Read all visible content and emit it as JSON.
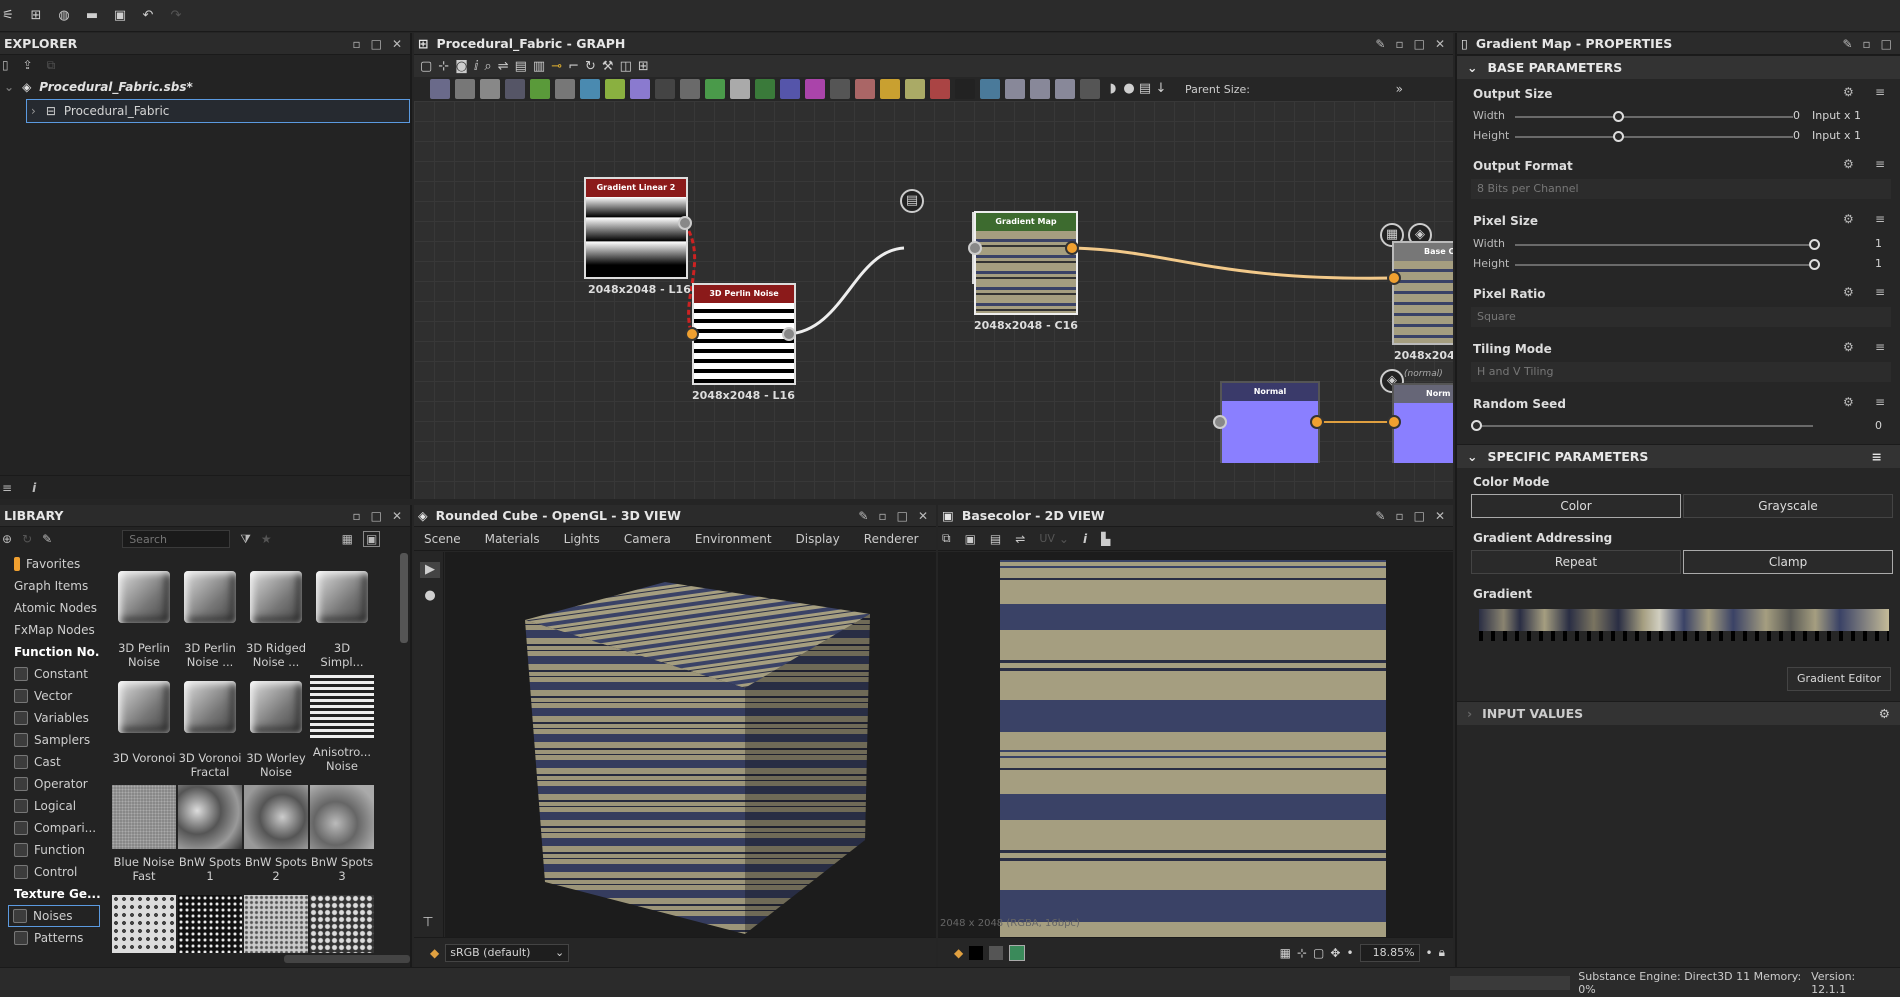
{
  "explorer": {
    "title": "EXPLORER",
    "package": "Procedural_Fabric.sbs*",
    "graph": "Procedural_Fabric"
  },
  "graph": {
    "title": "Procedural_Fabric - GRAPH",
    "parent_size_label": "Parent Size:",
    "nodes": {
      "gradient_linear": {
        "title": "Gradient Linear 2",
        "label": "2048x2048 - L16"
      },
      "perlin": {
        "title": "3D Perlin Noise",
        "label": "2048x2048 - L16"
      },
      "gradient_map": {
        "title": "Gradient Map",
        "label": "2048x2048 - C16"
      },
      "basecolor": {
        "title": "Base C",
        "label": "2048x204"
      },
      "normal": {
        "title": "Normal"
      },
      "normal_out": {
        "title": "Norm",
        "tag": "(normal)"
      }
    }
  },
  "library": {
    "title": "LIBRARY",
    "search_placeholder": "Search",
    "categories": [
      {
        "label": "Favorites",
        "bold": false
      },
      {
        "label": "Graph Items",
        "bold": false
      },
      {
        "label": "Atomic Nodes",
        "bold": false
      },
      {
        "label": "FxMap Nodes",
        "bold": false
      },
      {
        "label": "Function No...",
        "bold": true
      },
      {
        "label": "Constant",
        "bold": false
      },
      {
        "label": "Vector",
        "bold": false
      },
      {
        "label": "Variables",
        "bold": false
      },
      {
        "label": "Samplers",
        "bold": false
      },
      {
        "label": "Cast",
        "bold": false
      },
      {
        "label": "Operator",
        "bold": false
      },
      {
        "label": "Logical",
        "bold": false
      },
      {
        "label": "Compari...",
        "bold": false
      },
      {
        "label": "Function",
        "bold": false
      },
      {
        "label": "Control",
        "bold": false
      },
      {
        "label": "Texture Ge...",
        "bold": true
      },
      {
        "label": "Noises",
        "bold": false
      },
      {
        "label": "Patterns",
        "bold": false
      }
    ],
    "items": [
      {
        "l1": "3D Perlin",
        "l2": "Noise"
      },
      {
        "l1": "3D Perlin",
        "l2": "Noise ..."
      },
      {
        "l1": "3D Ridged",
        "l2": "Noise ..."
      },
      {
        "l1": "3D",
        "l2": "Simpl..."
      },
      {
        "l1": "3D Voronoi",
        "l2": ""
      },
      {
        "l1": "3D Voronoi",
        "l2": "Fractal"
      },
      {
        "l1": "3D Worley",
        "l2": "Noise"
      },
      {
        "l1": "Anisotro...",
        "l2": "Noise"
      },
      {
        "l1": "Blue Noise",
        "l2": "Fast"
      },
      {
        "l1": "BnW Spots",
        "l2": "1"
      },
      {
        "l1": "BnW Spots",
        "l2": "2"
      },
      {
        "l1": "BnW Spots",
        "l2": "3"
      }
    ]
  },
  "view3d": {
    "title": "Rounded Cube - OpenGL - 3D VIEW",
    "menu": [
      "Scene",
      "Materials",
      "Lights",
      "Camera",
      "Environment",
      "Display",
      "Renderer"
    ],
    "colorspace": "sRGB (default)"
  },
  "view2d": {
    "title": "Basecolor - 2D VIEW",
    "uv_label": "UV",
    "info": "2048 x 2048 (RGBA, 16bpc)",
    "zoom": "18.85%"
  },
  "properties": {
    "title": "Gradient Map - PROPERTIES",
    "base_header": "BASE PARAMETERS",
    "output_size": {
      "title": "Output Size",
      "width_label": "Width",
      "height_label": "Height",
      "width_val": "0",
      "height_val": "0",
      "width_mode": "Input x 1",
      "height_mode": "Input x 1"
    },
    "output_format": {
      "title": "Output Format",
      "value": "8 Bits per Channel"
    },
    "pixel_size": {
      "title": "Pixel Size",
      "width_label": "Width",
      "height_label": "Height",
      "width_val": "1",
      "height_val": "1"
    },
    "pixel_ratio": {
      "title": "Pixel Ratio",
      "value": "Square"
    },
    "tiling": {
      "title": "Tiling Mode",
      "value": "H and V Tiling"
    },
    "seed": {
      "title": "Random Seed",
      "value": "0"
    },
    "specific_header": "SPECIFIC PARAMETERS",
    "color_mode": {
      "title": "Color Mode",
      "opt1": "Color",
      "opt2": "Grayscale"
    },
    "addressing": {
      "title": "Gradient Addressing",
      "opt1": "Repeat",
      "opt2": "Clamp"
    },
    "gradient": {
      "title": "Gradient",
      "editor": "Gradient Editor"
    },
    "input_header": "INPUT VALUES"
  },
  "status": {
    "engine": "Substance Engine: Direct3D 11 Memory: 0%",
    "version": "Version: 12.1.1"
  },
  "colors": {
    "accent_orange": "#f0a030",
    "node_red": "#8b1a1a",
    "node_green": "#3d6b2f",
    "node_purple": "#8a7fff",
    "stripe_tan": "#a59e80",
    "stripe_navy": "#3a4266"
  }
}
